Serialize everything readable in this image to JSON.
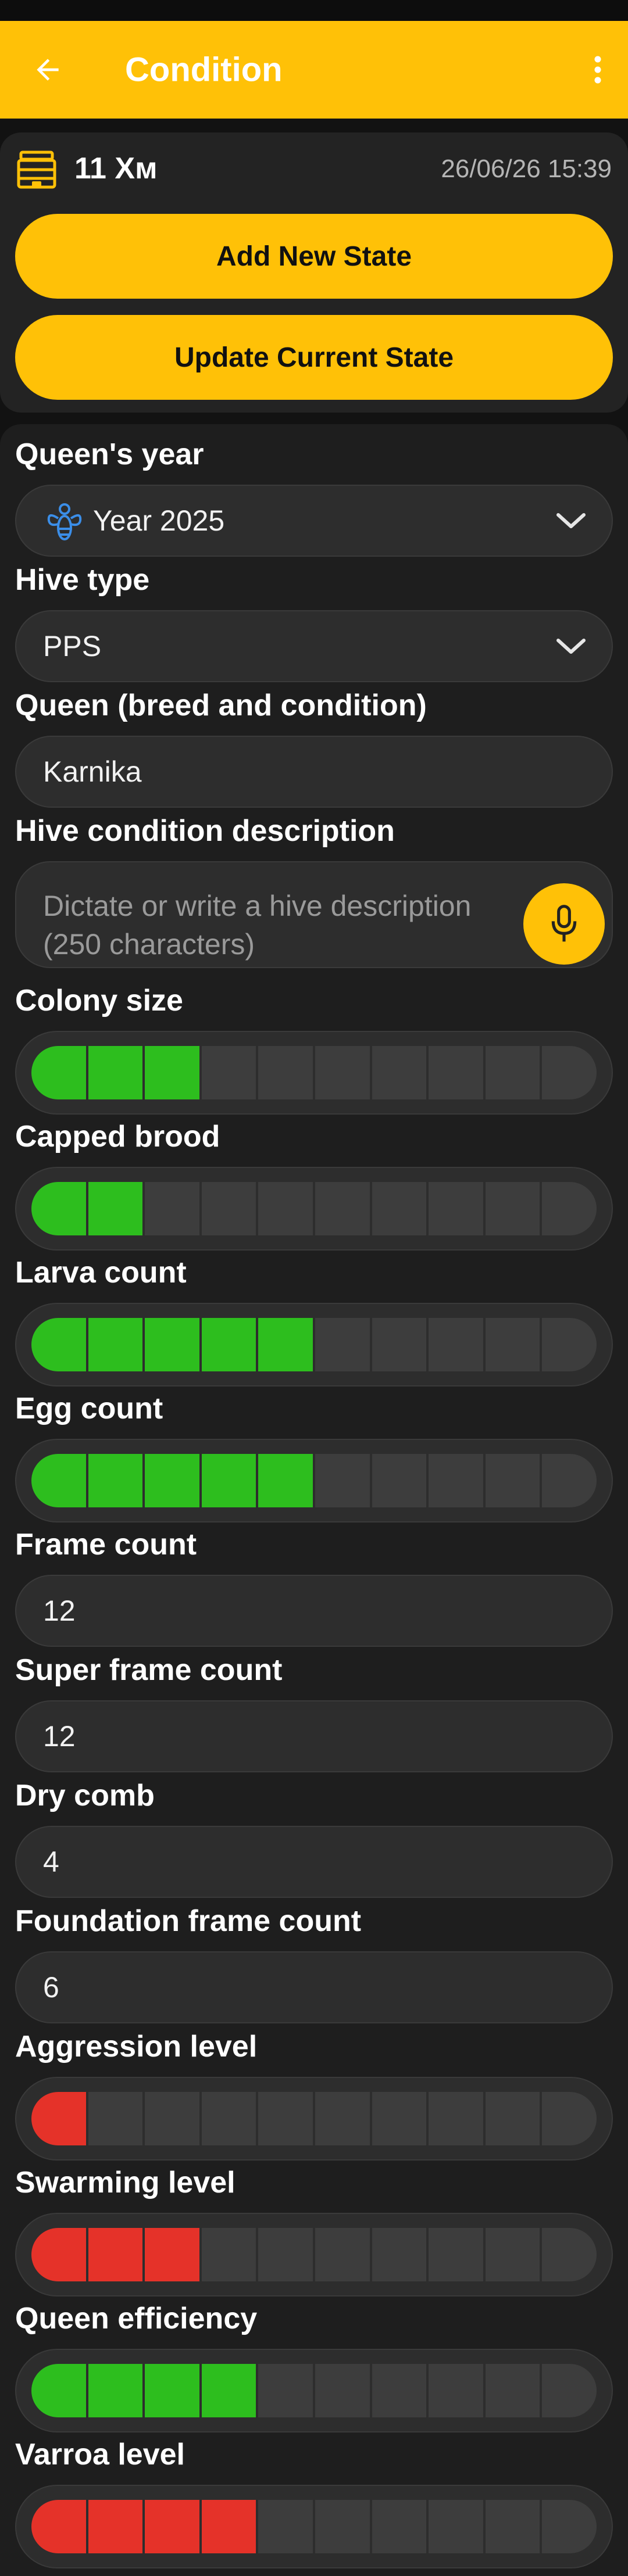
{
  "app_bar": {
    "title": "Condition",
    "back_icon": "arrow-left-icon",
    "menu_icon": "more-vert-icon"
  },
  "hive": {
    "name": "11 Хм",
    "date": "26/06/26 15:39",
    "icon": "beehive-icon"
  },
  "actions": {
    "add_new_state": "Add New State",
    "update_current_state": "Update Current State"
  },
  "fields": {
    "queen_year": {
      "label": "Queen's year",
      "value": "Year 2025",
      "icon": "queen-bee-icon"
    },
    "hive_type": {
      "label": "Hive type",
      "value": "PPS"
    },
    "queen_breed": {
      "label": "Queen (breed and condition)",
      "value": "Karnika"
    },
    "description": {
      "label": "Hive condition description",
      "placeholder": "Dictate or write a hive description (250 characters)",
      "icon": "microphone-icon"
    },
    "frame_count": {
      "label": "Frame count",
      "value": "12"
    },
    "super_frame_count": {
      "label": "Super frame count",
      "value": "12"
    },
    "dry_comb": {
      "label": "Dry comb",
      "value": "4"
    },
    "foundation_frame_count": {
      "label": "Foundation frame count",
      "value": "6"
    }
  },
  "ratings": {
    "colony_size": {
      "label": "Colony size",
      "value": 3,
      "max": 10,
      "color": "#2DBE1E"
    },
    "capped_brood": {
      "label": "Capped brood",
      "value": 2,
      "max": 10,
      "color": "#2DBE1E"
    },
    "larva_count": {
      "label": "Larva count",
      "value": 5,
      "max": 10,
      "color": "#2DBE1E"
    },
    "egg_count": {
      "label": "Egg count",
      "value": 5,
      "max": 10,
      "color": "#2DBE1E"
    },
    "aggression_level": {
      "label": "Aggression level",
      "value": 1,
      "max": 10,
      "color": "#E53229"
    },
    "swarming_level": {
      "label": "Swarming level",
      "value": 3,
      "max": 10,
      "color": "#E53229"
    },
    "queen_efficiency": {
      "label": "Queen efficiency",
      "value": 4,
      "max": 10,
      "color": "#2DBE1E"
    },
    "varroa_level": {
      "label": "Varroa level",
      "value": 4,
      "max": 10,
      "color": "#E53229"
    }
  },
  "colors": {
    "accent": "#FFC107",
    "good": "#2DBE1E",
    "bad": "#E53229"
  }
}
